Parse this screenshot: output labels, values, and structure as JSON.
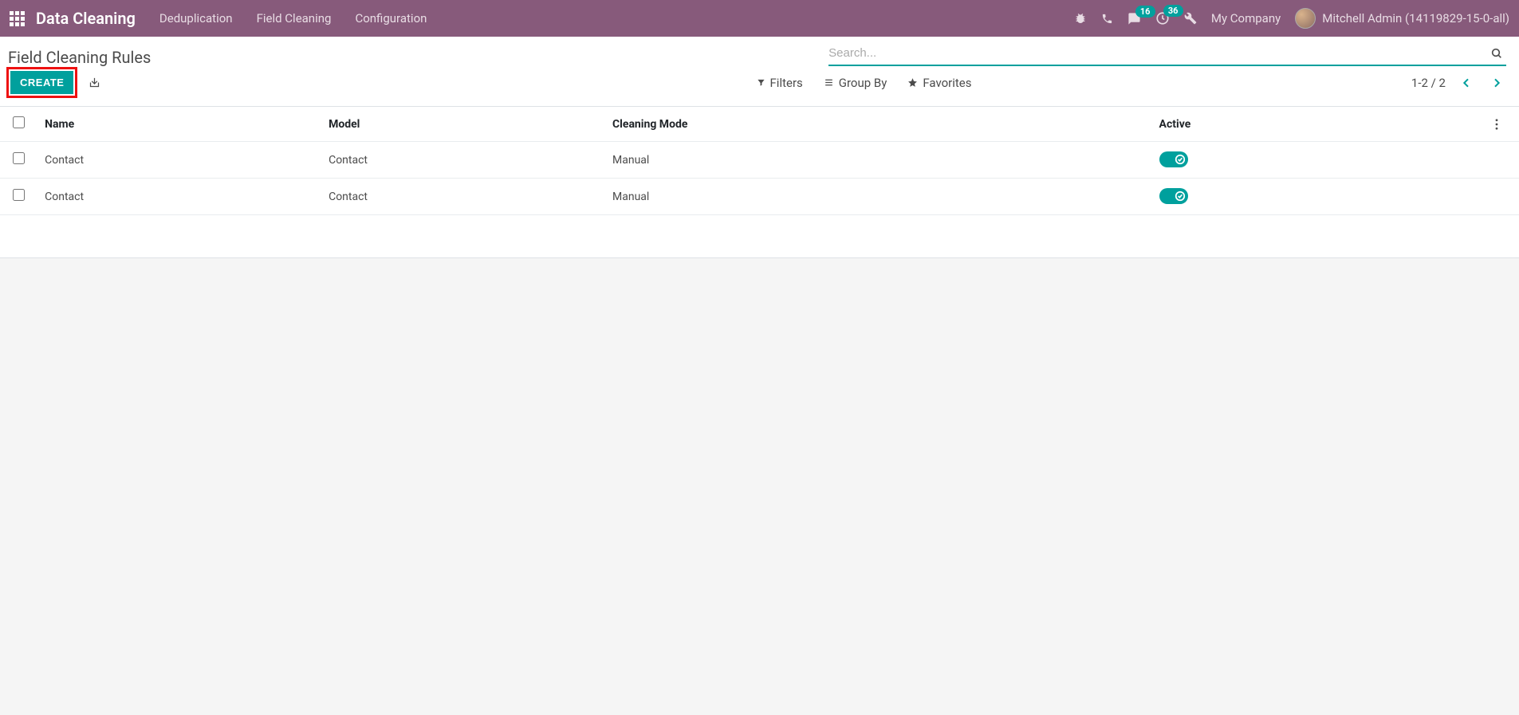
{
  "navbar": {
    "brand": "Data Cleaning",
    "menu": [
      "Deduplication",
      "Field Cleaning",
      "Configuration"
    ],
    "messages_badge": "16",
    "activities_badge": "36",
    "company": "My Company",
    "user": "Mitchell Admin (14119829-15-0-all)"
  },
  "header": {
    "title": "Field Cleaning Rules",
    "search_placeholder": "Search...",
    "create_label": "CREATE",
    "filters_label": "Filters",
    "groupby_label": "Group By",
    "favorites_label": "Favorites",
    "pager": "1-2 / 2"
  },
  "table": {
    "columns": {
      "name": "Name",
      "model": "Model",
      "mode": "Cleaning Mode",
      "active": "Active"
    },
    "rows": [
      {
        "name": "Contact",
        "model": "Contact",
        "mode": "Manual",
        "active": true
      },
      {
        "name": "Contact",
        "model": "Contact",
        "mode": "Manual",
        "active": true
      }
    ]
  }
}
